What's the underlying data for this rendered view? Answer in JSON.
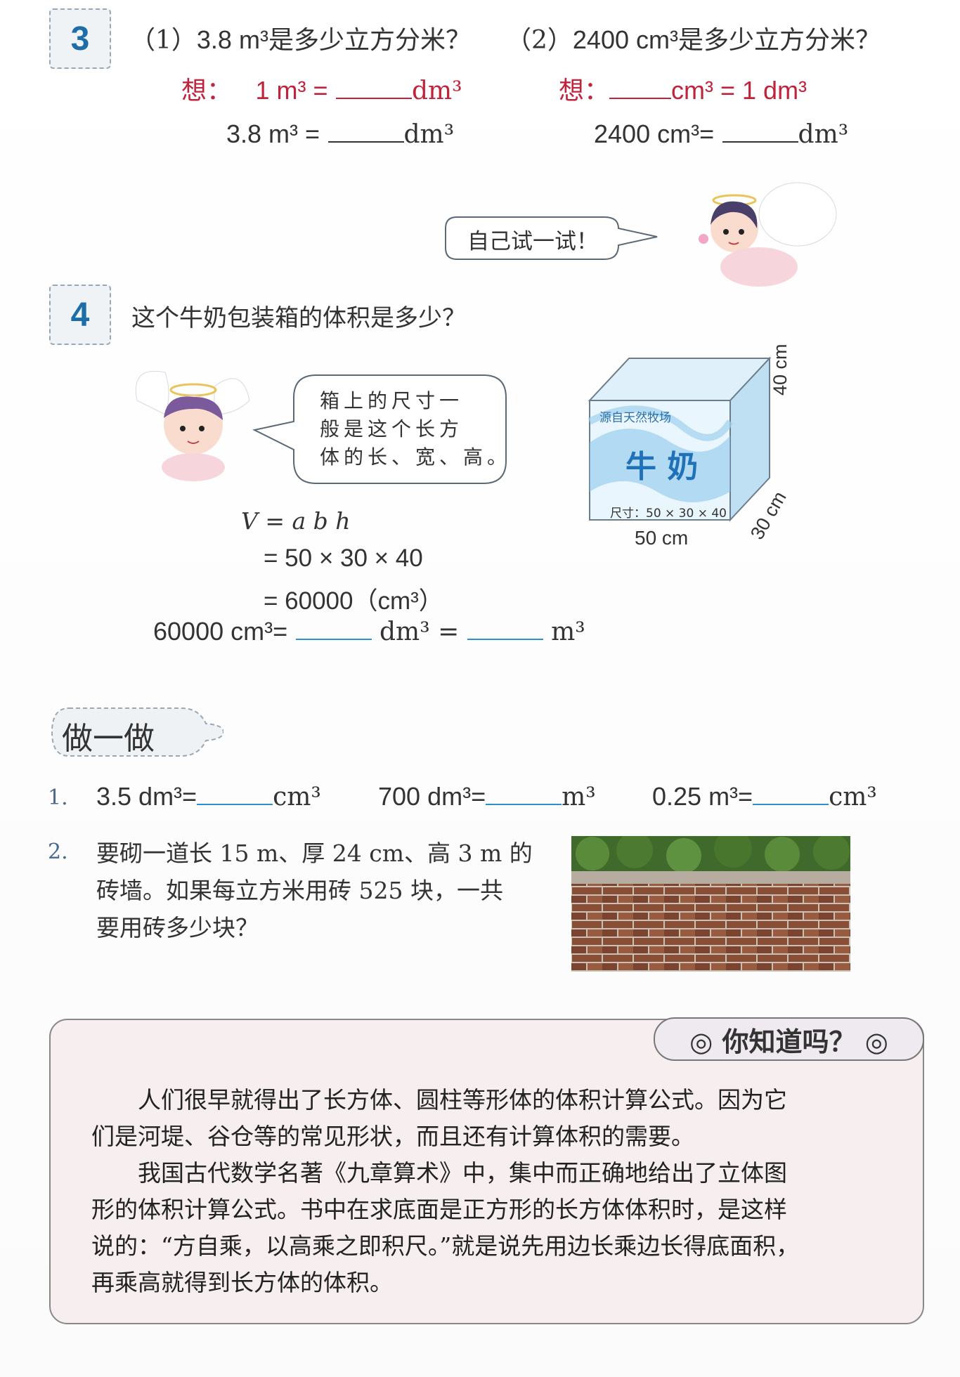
{
  "section3": {
    "number": "3",
    "q1": {
      "label": "（1）",
      "value": "3.8 m³",
      "question": "是多少立方分米？"
    },
    "q2": {
      "label": "（2）",
      "value": "2400 cm³",
      "question": "是多少立方分米？"
    },
    "think1": {
      "prefix": "想：",
      "left": "1 m³ =",
      "unit": "dm³"
    },
    "think2": {
      "prefix": "想：",
      "unit": "cm³ = 1 dm³"
    },
    "calc1": {
      "left": "3.8 m³ =",
      "unit": "dm³"
    },
    "calc2": {
      "left": "2400 cm³=",
      "unit": "dm³"
    },
    "try_bubble": "自己试一试！"
  },
  "section4": {
    "number": "4",
    "question": "这个牛奶包装箱的体积是多少？",
    "bubble_lines": [
      "箱上的尺寸一",
      "般是这个长方",
      "体的长、宽、高。"
    ],
    "box": {
      "brand": "源自天然牧场",
      "name": "牛 奶",
      "size_label": "尺寸：50 × 30 × 40",
      "height": "40 cm",
      "depth": "30 cm",
      "width": "50 cm"
    },
    "formula": [
      "V = a b h",
      "= 50 × 30 × 40",
      "= 60000（cm³）"
    ],
    "conversion": {
      "left": "60000 cm³=",
      "mid": "dm³ =",
      "right": "m³"
    }
  },
  "practice": {
    "title": "做一做",
    "item1": {
      "num": "1.",
      "a_left": "3.5 dm³=",
      "a_unit": "cm³",
      "b_left": "700 dm³=",
      "b_unit": "m³",
      "c_left": "0.25 m³=",
      "c_unit": "cm³"
    },
    "item2": {
      "num": "2.",
      "lines": [
        "要砌一道长 15 m、厚 24 cm、高 3 m 的",
        "砖墙。如果每立方米用砖 525 块，一共",
        "要用砖多少块？"
      ]
    }
  },
  "did_you_know": {
    "title": "你知道吗？",
    "paragraphs": [
      [
        "　　人们很早就得出了长方体、圆柱等形体的体积计算公式。因为它",
        "们是河堤、谷仓等的常见形状，而且还有计算体积的需要。"
      ],
      [
        "　　我国古代数学名著《九章算术》中，集中而正确地给出了立体图",
        "形的体积计算公式。书中在求底面是正方形的长方体体积时，是这样",
        "说的：“方自乘，以高乘之即积尺。”就是说先用边长乘边长得底面积，",
        "再乘高就得到长方体的体积。"
      ]
    ]
  },
  "colors": {
    "accent_blue": "#1d6ea8",
    "think_red": "#c0233b",
    "blank_blue": "#2b8fd1"
  }
}
